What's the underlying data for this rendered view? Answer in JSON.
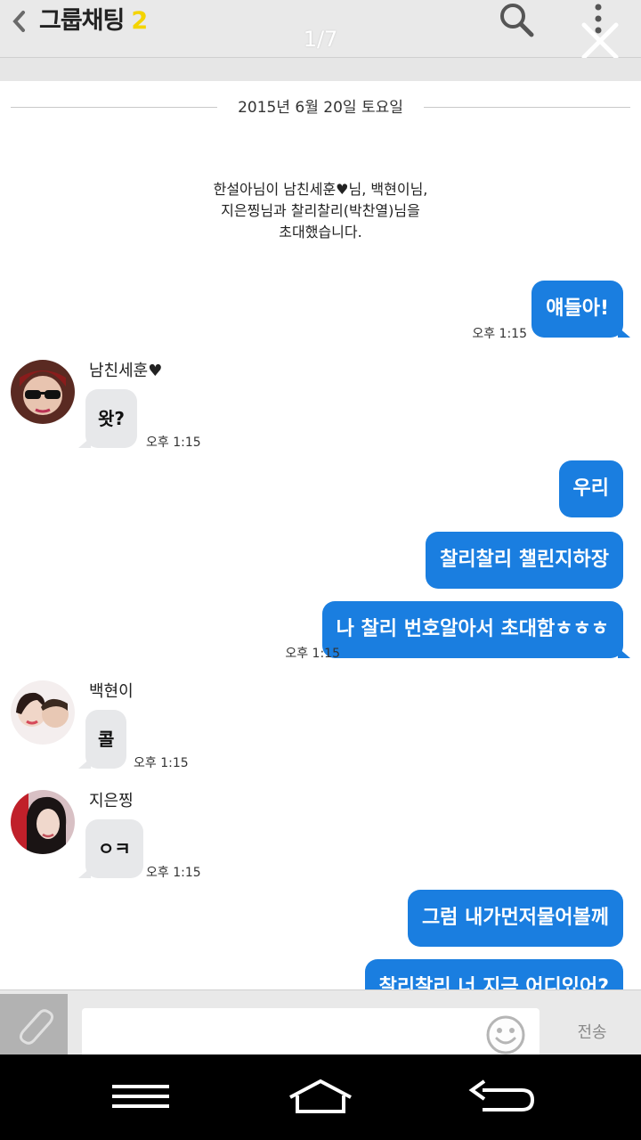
{
  "header": {
    "back_icon": "chevron-left-icon",
    "title": "그룹채팅",
    "member_count": "2",
    "image_counter": "1/7",
    "search_icon": "search-icon",
    "more_icon": "more-vertical-icon",
    "close_icon": "close-icon"
  },
  "colors": {
    "header_bg": "#e9e9e9",
    "count_accent": "#f4d400",
    "outgoing_bubble": "#1a7ee0",
    "incoming_bubble": "#e7e8ea"
  },
  "chat": {
    "date": "2015년 6월 20일 토요일",
    "system_message": {
      "line1": "한설아님이 남친세훈♥님, 백현이님,",
      "line2": "지은찡님과 찰리찰리(박찬열)님을",
      "line3": "초대했습니다."
    },
    "messages": [
      {
        "id": "m1",
        "direction": "out",
        "text": "얘들아!",
        "time": "오후 1:15"
      },
      {
        "id": "m2",
        "direction": "in",
        "sender": "남친세훈♥",
        "text": "왓?",
        "time": "오후 1:15"
      },
      {
        "id": "m3",
        "direction": "out",
        "text": "우리"
      },
      {
        "id": "m4",
        "direction": "out",
        "text": "찰리찰리 챌린지하장"
      },
      {
        "id": "m5",
        "direction": "out",
        "text": "나 찰리 번호알아서 초대함ㅎㅎㅎ",
        "time": "오후 1:15"
      },
      {
        "id": "m6",
        "direction": "in",
        "sender": "백현이",
        "text": "콜",
        "time": "오후 1:15"
      },
      {
        "id": "m7",
        "direction": "in",
        "sender": "지은찡",
        "text": "ㅇㅋ",
        "time": "오후 1:15"
      },
      {
        "id": "m8",
        "direction": "out",
        "text": "그럼 내가먼저물어볼께"
      },
      {
        "id": "m9",
        "direction": "out",
        "text": "찰리찰리 너 지금 어디있어?"
      }
    ]
  },
  "input": {
    "attach_icon": "paperclip-icon",
    "value": "",
    "emoji_icon": "smiley-icon",
    "send_label": "전송"
  },
  "navbar": {
    "menu_icon": "menu-icon",
    "home_icon": "home-icon",
    "back_icon": "back-arrow-icon"
  }
}
